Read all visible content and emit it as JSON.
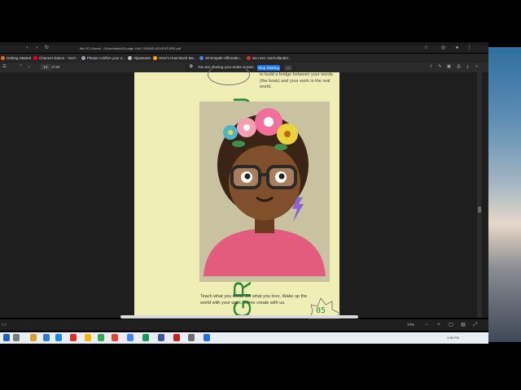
{
  "browser": {
    "address": "file:///C:/Users/.../Downloads/04-page 1##1 GRAND ADVENTURE.pdf",
    "bookmarks": [
      {
        "label": "Getting Started",
        "color": "#e8710a"
      },
      {
        "label": "Channel videos - YouT...",
        "color": "#ff0000"
      },
      {
        "label": "Please confirm your e...",
        "color": "#9aa0a6"
      },
      {
        "label": "Vipassana",
        "color": "#bdbdbd"
      },
      {
        "label": "Here's How Much Me...",
        "color": "#f9ab00"
      },
      {
        "label": "30 Empath Affirmatio...",
        "color": "#4285f4"
      },
      {
        "label": "ian ross: ianrhollander...",
        "color": "#d93025"
      }
    ]
  },
  "pdf_toolbar": {
    "page_current": "14",
    "page_total": "of 28",
    "share_message": "You are sharing your entire screen.",
    "stop_sharing": "Stop Sharing",
    "hide": "Hide"
  },
  "pdf_page": {
    "vertical_title": "GRAND ADVENTU",
    "top_copy": "to build a bridge between your words (the book) and your work in the real world.",
    "footer_copy": "Teach what you know. Do what you love. Wake up the world with your work. Come create with us.",
    "page_number": "05"
  },
  "status": {
    "zoom": "74%"
  },
  "taskbar": {
    "clock": "1:36 PM"
  },
  "colors": {
    "accent_green": "#2e8a3e",
    "page_bg": "#efefb5",
    "stop_blue": "#1a73e8"
  }
}
